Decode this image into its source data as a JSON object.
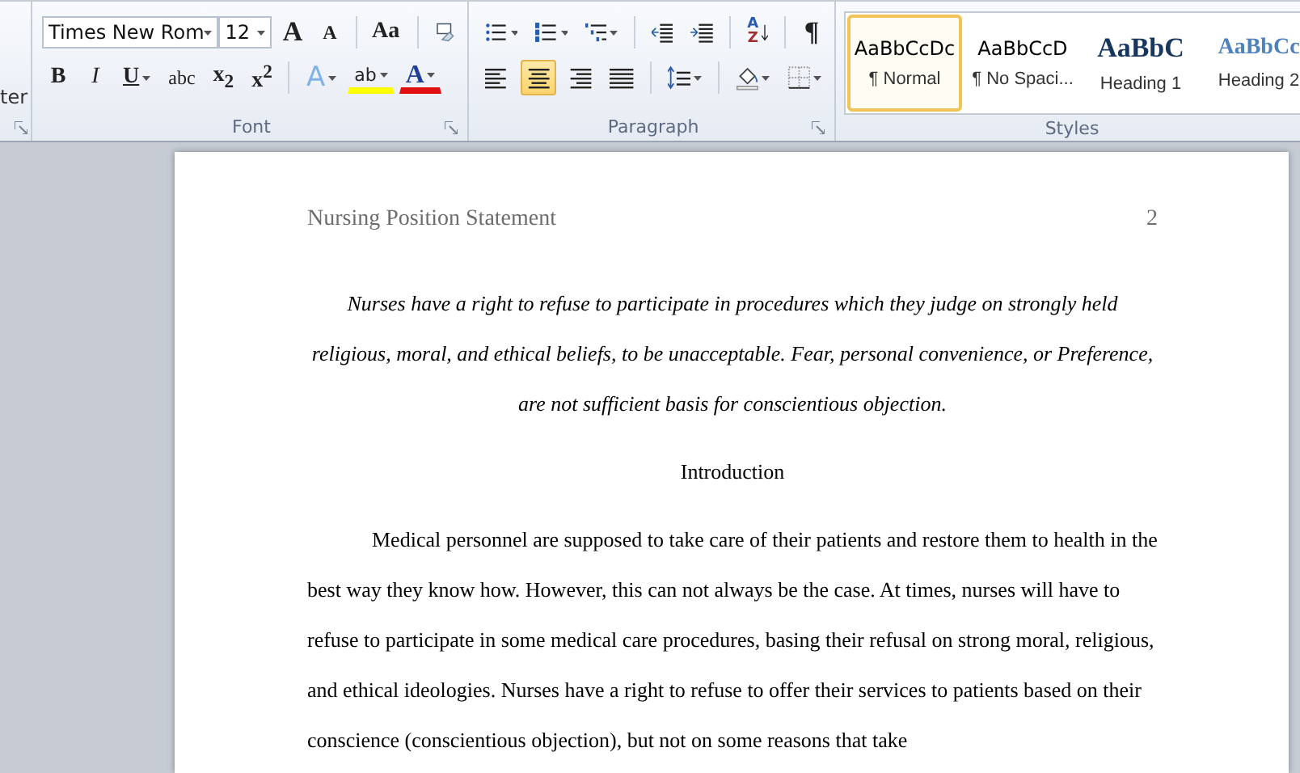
{
  "ribbon": {
    "clipped_group_label": "ter",
    "font": {
      "label": "Font",
      "font_name": "Times New Rom",
      "font_size": "12",
      "grow": "A",
      "shrink": "A",
      "change_case": "Aa",
      "format_buttons": [
        {
          "kind": "bold",
          "label": "B"
        },
        {
          "kind": "italic",
          "label": "I"
        },
        {
          "kind": "underline",
          "label": "U"
        },
        {
          "kind": "strike",
          "label": "abc"
        },
        {
          "kind": "subscript",
          "label": "x$_{2}$"
        },
        {
          "kind": "superscript",
          "label": "x$^{2}$"
        }
      ],
      "text_effects": "A",
      "highlight": "ab",
      "font_color": "A"
    },
    "paragraph": {
      "label": "Paragraph",
      "sort_top": "A",
      "sort_bottom": "Z",
      "show_marks": "¶",
      "alignment": [
        {
          "kind": "left",
          "selected": false
        },
        {
          "kind": "center",
          "selected": true
        },
        {
          "kind": "right",
          "selected": false
        },
        {
          "kind": "justify",
          "selected": false
        }
      ]
    },
    "styles": {
      "label": "Styles",
      "items": [
        {
          "kind": "normal",
          "sample": "AaBbCcDc",
          "name": "¶ Normal",
          "selected": true
        },
        {
          "kind": "normal",
          "sample": "AaBbCcD",
          "name": "¶ No Spaci...",
          "selected": false
        },
        {
          "kind": "heading1",
          "sample": "AaBbC",
          "name": "Heading 1",
          "selected": false
        },
        {
          "kind": "heading2",
          "sample": "AaBbCc",
          "name": "Heading 2",
          "selected": false
        }
      ]
    }
  },
  "document": {
    "header_title": "Nursing Position Statement",
    "page_number": "2",
    "epigraph": "Nurses have a right to refuse to participate in procedures which they judge on strongly held religious, moral, and ethical beliefs, to be unacceptable. Fear, personal convenience, or Preference, are not sufficient basis for conscientious objection.",
    "heading": "Introduction",
    "body": "Medical personnel are supposed to take care of their patients and restore them to health in the best way they know how. However, this can not always be the case. At times, nurses will have to refuse to participate in some medical care procedures, basing their refusal on strong moral, religious, and ethical ideologies. Nurses have a right to refuse to offer their services to patients based on their conscience (conscientious objection), but not on some reasons that take"
  }
}
